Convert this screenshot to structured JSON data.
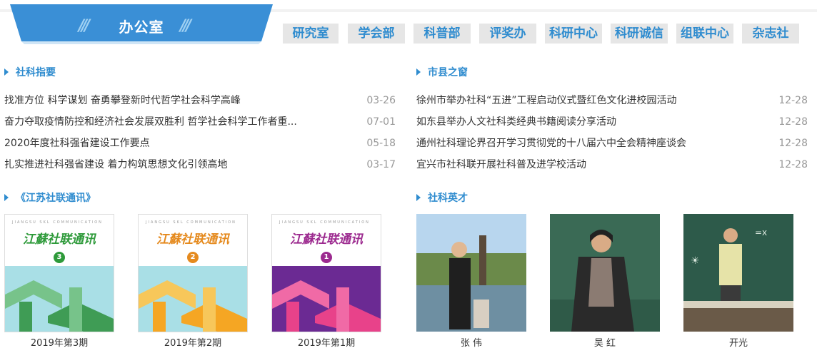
{
  "header": {
    "office_title": "办公室",
    "nav": [
      {
        "label": "研究室"
      },
      {
        "label": "学会部"
      },
      {
        "label": "科普部"
      },
      {
        "label": "评奖办"
      },
      {
        "label": "科研中心"
      },
      {
        "label": "科研诚信"
      },
      {
        "label": "组联中心"
      },
      {
        "label": "杂志社"
      }
    ]
  },
  "guide": {
    "title": "社科指要",
    "items": [
      {
        "text": "找准方位 科学谋划 奋勇攀登新时代哲学社会科学高峰",
        "date": "03-26"
      },
      {
        "text": "奋力夺取疫情防控和经济社会发展双胜利 哲学社会科学工作者重...",
        "date": "07-01"
      },
      {
        "text": "2020年度社科强省建设工作要点",
        "date": "05-18"
      },
      {
        "text": "扎实推进社科强省建设 着力构筑思想文化引领高地",
        "date": "03-17"
      }
    ]
  },
  "county": {
    "title": "市县之窗",
    "items": [
      {
        "text": "徐州市举办社科“五进”工程启动仪式暨红色文化进校园活动",
        "date": "12-28"
      },
      {
        "text": "如东县举办人文社科类经典书籍阅读分享活动",
        "date": "12-28"
      },
      {
        "text": "通州社科理论界召开学习贯彻党的十八届六中全会精神座谈会",
        "date": "12-28"
      },
      {
        "text": "宜兴市社科联开展社科普及进学校活动",
        "date": "12-28"
      }
    ]
  },
  "magazine": {
    "title": "《江苏社联通讯》",
    "issues": [
      {
        "cover_title": "江蘇社联通讯",
        "cover_sub": "JIANGSU SKL COMMUNICATION",
        "num": "3",
        "caption": "2019年第3期",
        "color_title": "#2e9a3a",
        "color_bg": "#a9dfe6",
        "color_shape": "#3f9c55",
        "color_shape2": "#77c38a"
      },
      {
        "cover_title": "江蘇社联通讯",
        "cover_sub": "JIANGSU SKL COMMUNICATION",
        "num": "2",
        "caption": "2019年第2期",
        "color_title": "#e58a1e",
        "color_bg": "#a9dfe6",
        "color_shape": "#f5a623",
        "color_shape2": "#f7c75a"
      },
      {
        "cover_title": "江蘇社联通讯",
        "cover_sub": "JIANGSU SKL COMMUNICATION",
        "num": "1",
        "caption": "2019年第1期",
        "color_title": "#9c2a8f",
        "color_bg": "#6b2a93",
        "color_shape": "#e8428a",
        "color_shape2": "#f06aa6"
      }
    ]
  },
  "talent": {
    "title": "社科英才",
    "people": [
      {
        "name": "张 伟"
      },
      {
        "name": "吴 红"
      },
      {
        "name": "开光"
      }
    ]
  },
  "colors": {
    "accent": "#2f8ccf",
    "tab_bg": "#3a8fd6",
    "nav_bg": "#e6e6e6"
  }
}
